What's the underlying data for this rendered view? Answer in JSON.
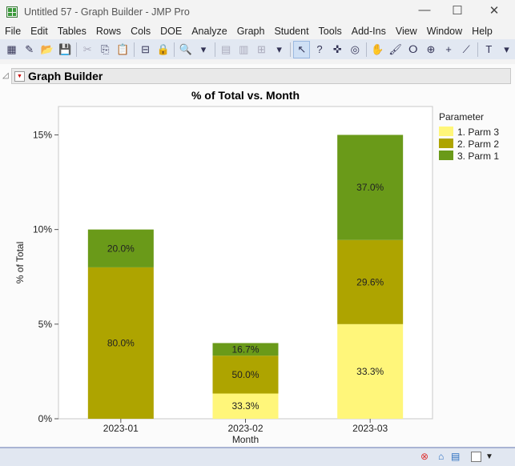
{
  "window": {
    "title": "Untitled 57 - Graph Builder - JMP Pro",
    "minimize": "—",
    "maximize": "☐",
    "close": "✕"
  },
  "menu": [
    "File",
    "Edit",
    "Tables",
    "Rows",
    "Cols",
    "DOE",
    "Analyze",
    "Graph",
    "Student",
    "Tools",
    "Add-Ins",
    "View",
    "Window",
    "Help"
  ],
  "toolbar_icons": [
    {
      "name": "new-data-table-icon",
      "glyph": "▦"
    },
    {
      "name": "new-script-icon",
      "glyph": "✎"
    },
    {
      "name": "open-icon",
      "glyph": "📂"
    },
    {
      "name": "save-icon",
      "glyph": "💾"
    },
    {
      "sep": true
    },
    {
      "name": "cut-icon",
      "glyph": "✂",
      "dis": true
    },
    {
      "name": "copy-icon",
      "glyph": "⎘"
    },
    {
      "name": "paste-icon",
      "glyph": "📋"
    },
    {
      "sep": true
    },
    {
      "name": "journal-icon",
      "glyph": "⊟"
    },
    {
      "name": "lock-icon",
      "glyph": "🔒",
      "dis": true
    },
    {
      "sep": true
    },
    {
      "name": "search-icon",
      "glyph": "🔍"
    },
    {
      "name": "overflow-icon",
      "glyph": "▾"
    },
    {
      "sep": true
    },
    {
      "name": "data-grid-icon",
      "glyph": "▤",
      "dis": true
    },
    {
      "name": "columns-icon",
      "glyph": "▥",
      "dis": true
    },
    {
      "name": "add-rows-icon",
      "glyph": "⊞",
      "dis": true
    },
    {
      "name": "overflow-icon",
      "glyph": "▾"
    },
    {
      "sep": true
    },
    {
      "name": "arrow-tool-icon",
      "glyph": "↖",
      "sel": true
    },
    {
      "name": "help-tool-icon",
      "glyph": "?"
    },
    {
      "name": "crosshair-tool-icon",
      "glyph": "✜"
    },
    {
      "name": "target-tool-icon",
      "glyph": "◎"
    },
    {
      "sep": true
    },
    {
      "name": "hand-tool-icon",
      "glyph": "✋"
    },
    {
      "name": "brush-tool-icon",
      "glyph": "🖌"
    },
    {
      "name": "lasso-tool-icon",
      "glyph": "ⵔ"
    },
    {
      "name": "zoom-tool-icon",
      "glyph": "⊕"
    },
    {
      "name": "crosshairs-icon",
      "glyph": "+"
    },
    {
      "name": "ruler-icon",
      "glyph": "⟋"
    },
    {
      "sep": true
    },
    {
      "name": "annotate-icon",
      "glyph": "T"
    },
    {
      "name": "overflow-icon",
      "glyph": "▾"
    }
  ],
  "outline": {
    "title": "Graph Builder"
  },
  "chart_data": {
    "type": "bar",
    "stacked": true,
    "title": "% of Total vs. Month",
    "xlabel": "Month",
    "ylabel": "% of Total",
    "ylim": [
      0,
      16.5
    ],
    "yticks": [
      0,
      5,
      10,
      15
    ],
    "ytick_labels": [
      "0%",
      "5%",
      "10%",
      "15%"
    ],
    "categories": [
      "2023-01",
      "2023-02",
      "2023-03"
    ],
    "legend": {
      "title": "Parameter",
      "position": "right"
    },
    "series": [
      {
        "name": "1. Parm 3",
        "color": "#fff67a",
        "values": [
          0,
          1.333,
          5.0
        ],
        "labels": [
          "",
          "33.3%",
          "33.3%"
        ]
      },
      {
        "name": "2. Parm 2",
        "color": "#aea400",
        "values": [
          8.0,
          2.0,
          4.444
        ],
        "labels": [
          "80.0%",
          "50.0%",
          "29.6%"
        ]
      },
      {
        "name": "3. Parm 1",
        "color": "#6a9a19",
        "values": [
          2.0,
          0.667,
          5.556
        ],
        "labels": [
          "20.0%",
          "16.7%",
          "37.0%"
        ]
      }
    ]
  }
}
